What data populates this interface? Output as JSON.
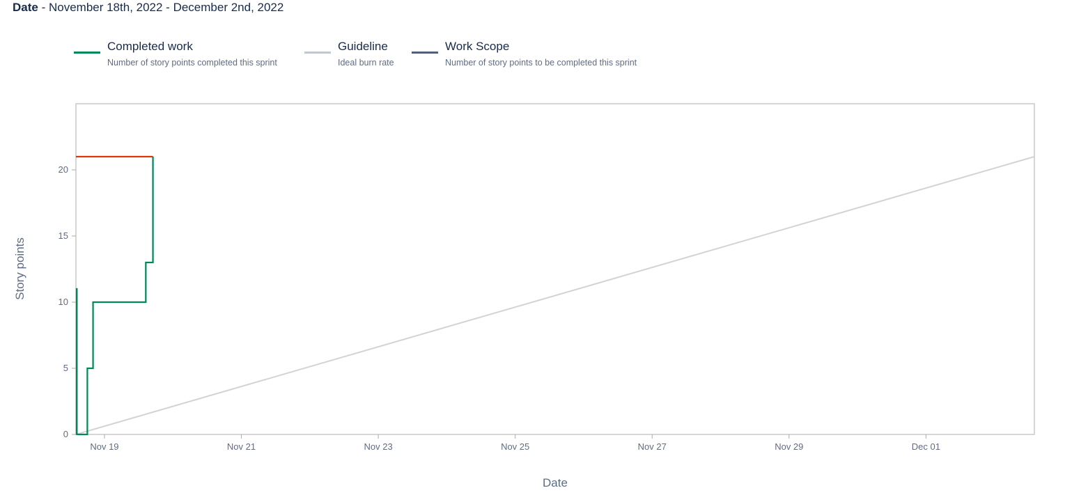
{
  "header": {
    "date_label": "Date",
    "date_range": " - November 18th, 2022 - December 2nd, 2022"
  },
  "legend": [
    {
      "title": "Completed work",
      "description": "Number of story points completed this sprint",
      "color": "#00875a"
    },
    {
      "title": "Guideline",
      "description": "Ideal burn rate",
      "color": "#c1c7d0"
    },
    {
      "title": "Work Scope",
      "description": "Number of story points to be completed this sprint",
      "color": "#505f79"
    }
  ],
  "chart_data": {
    "type": "line",
    "xlabel": "Date",
    "ylabel": "Story points",
    "xlim": [
      "2022-11-18T14:00",
      "2022-12-02T14:00"
    ],
    "ylim": [
      0,
      25
    ],
    "x_ticks": [
      "Nov 19",
      "Nov 21",
      "Nov 23",
      "Nov 25",
      "Nov 27",
      "Nov 29",
      "Dec 01"
    ],
    "y_ticks": [
      0,
      5,
      10,
      15,
      20
    ],
    "grid": false,
    "legend_position": "top",
    "series": [
      {
        "name": "Completed work",
        "color": "#00875a",
        "step": true,
        "x": [
          "2022-11-18T14:15",
          "2022-11-18T14:15",
          "2022-11-18T14:20",
          "2022-11-18T14:20",
          "2022-11-18T18:00",
          "2022-11-18T18:00",
          "2022-11-18T20:00",
          "2022-11-18T20:00",
          "2022-11-19T14:30",
          "2022-11-19T14:30",
          "2022-11-19T17:00",
          "2022-11-19T17:00"
        ],
        "values": [
          0,
          11,
          11,
          0,
          0,
          5,
          5,
          10,
          10,
          13,
          13,
          21
        ]
      },
      {
        "name": "Work Scope",
        "color": "#de350b",
        "x": [
          "2022-11-18T14:00",
          "2022-11-19T17:00"
        ],
        "values": [
          21,
          21
        ]
      },
      {
        "name": "Guideline",
        "color": "#d3d3d3",
        "x": [
          "2022-11-18T14:00",
          "2022-12-02T14:00"
        ],
        "values": [
          0,
          21
        ]
      }
    ]
  }
}
